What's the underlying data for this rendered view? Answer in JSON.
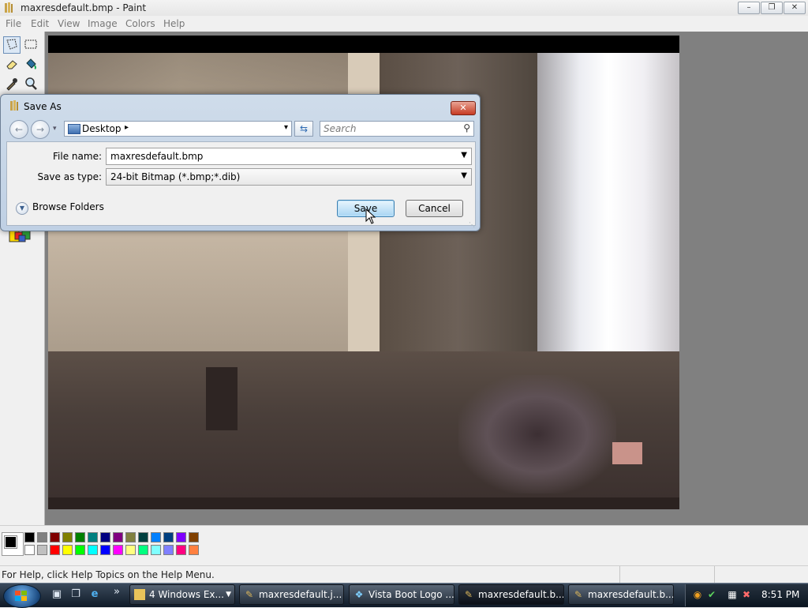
{
  "window": {
    "title": "maxresdefault.bmp - Paint",
    "buttons": {
      "minimize": "–",
      "maximize": "❐",
      "close": "✕"
    }
  },
  "menu": [
    "File",
    "Edit",
    "View",
    "Image",
    "Colors",
    "Help"
  ],
  "toolbox": {
    "tools": [
      "free-form-select",
      "select",
      "eraser",
      "fill-with-color",
      "pick-color",
      "magnifier"
    ]
  },
  "palette": {
    "colors": [
      "#000000",
      "#808080",
      "#800000",
      "#808000",
      "#008000",
      "#008080",
      "#000080",
      "#800080",
      "#808040",
      "#004040",
      "#0080ff",
      "#004080",
      "#8000ff",
      "#804000",
      "#ffffff",
      "#c0c0c0",
      "#ff0000",
      "#ffff00",
      "#00ff00",
      "#00ffff",
      "#0000ff",
      "#ff00ff",
      "#ffff80",
      "#00ff80",
      "#80ffff",
      "#8080ff",
      "#ff0080",
      "#ff8040"
    ]
  },
  "status": {
    "help_text": "For Help, click Help Topics on the Help Menu."
  },
  "dialog": {
    "title": "Save As",
    "close": "✕",
    "address": {
      "location": "Desktop",
      "arrow": "▸",
      "dropdown": "▾"
    },
    "search_placeholder": "Search",
    "file_name_label": "File name:",
    "file_name_value": "maxresdefault.bmp",
    "save_type_label": "Save as type:",
    "save_type_value": "24-bit Bitmap (*.bmp;*.dib)",
    "browse_folders": "Browse Folders",
    "save_button": "Save",
    "cancel_button": "Cancel"
  },
  "taskbar": {
    "tasks": [
      {
        "label": "4 Windows Ex...",
        "icon": "folder-icon"
      },
      {
        "label": "maxresdefault.j...",
        "icon": "paint-icon"
      },
      {
        "label": "Vista Boot Logo ...",
        "icon": "app-icon"
      },
      {
        "label": "maxresdefault.b...",
        "icon": "paint-icon"
      },
      {
        "label": "maxresdefault.b...",
        "icon": "paint-icon"
      }
    ],
    "quicklaunch_more": "»",
    "clock": "8:51 PM"
  }
}
